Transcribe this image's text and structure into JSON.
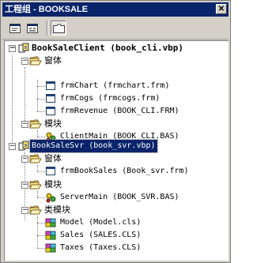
{
  "window": {
    "title": "工程组 - BOOKSALE",
    "close_glyph": "✕"
  },
  "toolbar": {
    "buttons": [
      "view-code",
      "view-object",
      "toggle-folders"
    ]
  },
  "tree": {
    "project1": {
      "label": "BookSaleClient (book_cli.vbp)",
      "forms_folder": "窗体",
      "forms": [
        "frmChart (frmchart.frm)",
        "frmCogs (frmcogs.frm)",
        "frmRevenue (BOOK_CLI.FRM)"
      ],
      "modules_folder": "模块",
      "modules": [
        "ClientMain (BOOK_CLI.BAS)"
      ]
    },
    "project2": {
      "label": "BookSaleSvr (book_svr.vbp)",
      "forms_folder": "窗体",
      "forms": [
        "frmBookSales (Book_svr.frm)"
      ],
      "modules_folder": "模块",
      "modules": [
        "ServerMain (BOOK_SVR.BAS)"
      ],
      "classes_folder": "类模块",
      "classes": [
        "Model (Model.cls)",
        "Sales (SALES.CLS)",
        "Taxes (Taxes.CLS)"
      ]
    }
  }
}
